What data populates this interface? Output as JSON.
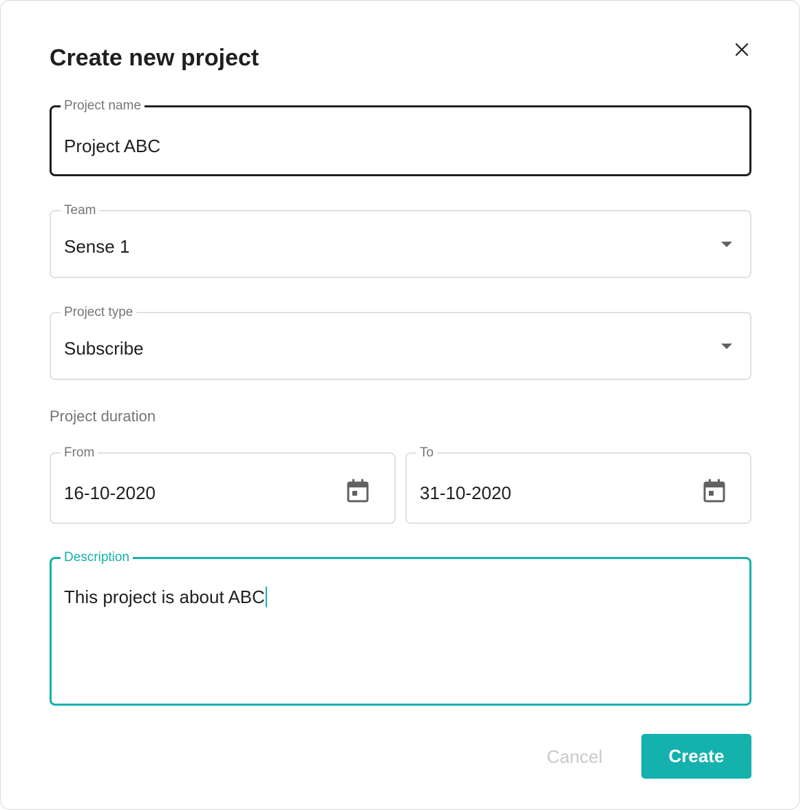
{
  "dialog": {
    "title": "Create new project",
    "close_icon": "close-icon"
  },
  "form": {
    "project_name": {
      "label": "Project name",
      "value": "Project ABC"
    },
    "team": {
      "label": "Team",
      "value": "Sense 1",
      "icon": "chevron-down-icon"
    },
    "project_type": {
      "label": "Project type",
      "value": "Subscribe",
      "icon": "chevron-down-icon"
    },
    "duration": {
      "label": "Project duration",
      "from": {
        "label": "From",
        "value": "16-10-2020",
        "icon": "calendar-icon"
      },
      "to": {
        "label": "To",
        "value": "31-10-2020",
        "icon": "calendar-icon"
      }
    },
    "description": {
      "label": "Description",
      "value": "This project is about ABC"
    }
  },
  "actions": {
    "cancel_label": "Cancel",
    "create_label": "Create"
  },
  "colors": {
    "accent": "#14b1ad",
    "focused_border": "#1f1f1f",
    "border": "#e0e0e0",
    "label": "#757575",
    "text": "#1f1f1f",
    "disabled": "#c9c9c9"
  }
}
